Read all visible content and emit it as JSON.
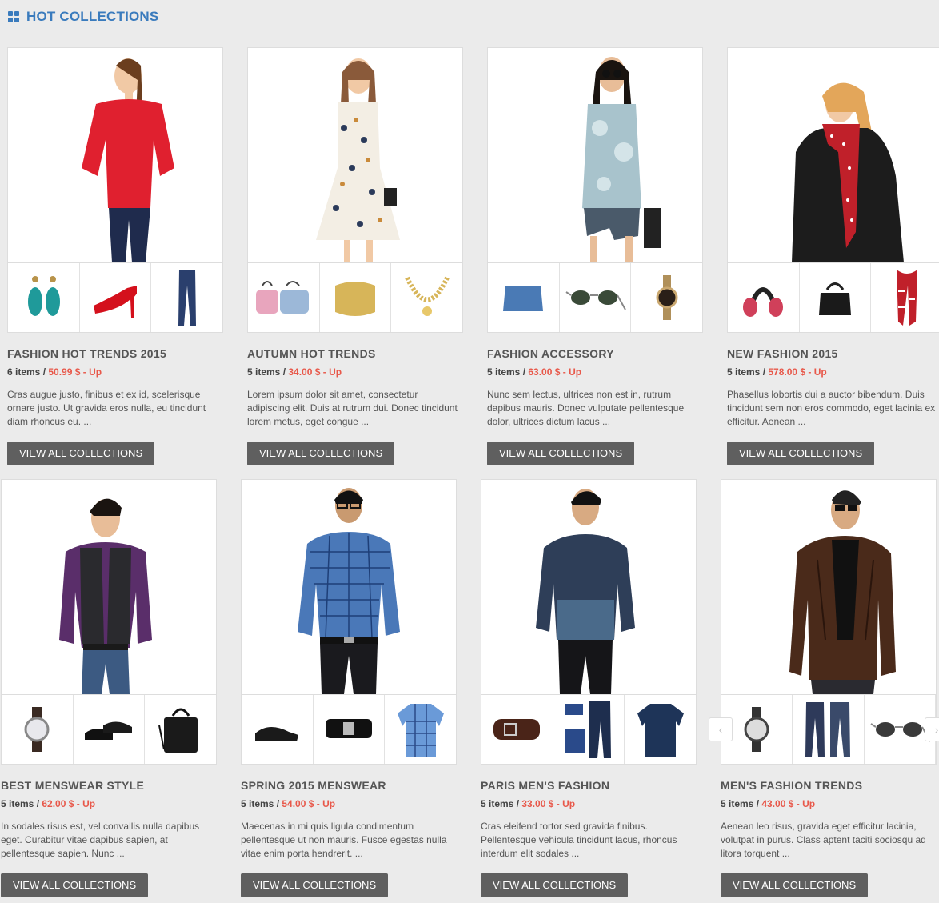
{
  "section": {
    "title": "HOT COLLECTIONS",
    "icon": "grid-icon"
  },
  "collections": [
    {
      "title": "FASHION HOT TRENDS 2015",
      "count": "6 items",
      "sep": " / ",
      "price": "50.99 $ - Up",
      "desc": "Cras augue justo, finibus et ex id, scelerisque ornare justo. Ut gravida eros nulla, eu tincidunt diam rhoncus eu. ...",
      "button": "VIEW ALL COLLECTIONS",
      "model": "woman in red blouse and jeans",
      "thumbs": [
        "turquoise earrings",
        "red high heel",
        "blue jeans"
      ]
    },
    {
      "title": "AUTUMN HOT TRENDS",
      "count": "5 items",
      "sep": " / ",
      "price": "34.00 $ - Up",
      "desc": "Lorem ipsum dolor sit amet, consectetur adipiscing elit. Duis at rutrum dui. Donec tincidunt lorem metus, eget congue ...",
      "button": "VIEW ALL COLLECTIONS",
      "model": "woman in floral dress",
      "thumbs": [
        "handbags",
        "gold cuff bracelet",
        "gold necklace"
      ]
    },
    {
      "title": "FASHION ACCESSORY",
      "count": "5 items",
      "sep": " / ",
      "price": "63.00 $ - Up",
      "desc": "Nunc sem lectus, ultrices non est in, rutrum dapibus mauris. Donec vulputate pellentesque dolor, ultrices dictum lacus ...",
      "button": "VIEW ALL COLLECTIONS",
      "model": "woman in tie-dye top and denim shorts",
      "thumbs": [
        "denim skirt",
        "aviator sunglasses",
        "wrist watch"
      ]
    },
    {
      "title": "NEW FASHION 2015",
      "count": "5 items",
      "sep": " / ",
      "price": "578.00 $ - Up",
      "desc": "Phasellus lobortis dui a auctor bibendum. Duis tincidunt sem non eros commodo, eget lacinia ex efficitur. Aenean ...",
      "button": "VIEW ALL COLLECTIONS",
      "model": "woman in black coat and red scarf",
      "thumbs": [
        "earmuffs",
        "black handbag",
        "knit scarf"
      ]
    },
    {
      "title": "BEST MENSWEAR STYLE",
      "count": "5 items",
      "sep": " / ",
      "price": "62.00 $ - Up",
      "desc": "In sodales risus est, vel convallis nulla dapibus eget. Curabitur vitae dapibus sapien, at pellentesque sapien. Nunc ...",
      "button": "VIEW ALL COLLECTIONS",
      "model": "man in black vest",
      "thumbs": [
        "wrist watch",
        "dress shoes",
        "leather bag"
      ]
    },
    {
      "title": "SPRING 2015 MENSWEAR",
      "count": "5 items",
      "sep": " / ",
      "price": "54.00 $ - Up",
      "desc": "Maecenas in mi quis ligula condimentum pellentesque ut non mauris. Fusce egestas nulla vitae enim porta hendrerit. ...",
      "button": "VIEW ALL COLLECTIONS",
      "model": "man in blue plaid shirt",
      "thumbs": [
        "black shoe",
        "black belt",
        "plaid shirt"
      ]
    },
    {
      "title": "PARIS MEN'S FASHION",
      "count": "5 items",
      "sep": " / ",
      "price": "33.00 $ - Up",
      "desc": "Cras eleifend tortor sed gravida finibus. Pellentesque vehicula tincidunt lacus, rhoncus interdum elit sodales ...",
      "button": "VIEW ALL COLLECTIONS",
      "model": "man in denim shirt",
      "thumbs": [
        "brown belt",
        "jeans set",
        "denim shirt"
      ]
    },
    {
      "title": "MEN'S FASHION TRENDS",
      "count": "5 items",
      "sep": " / ",
      "price": "43.00 $ - Up",
      "desc": "Aenean leo risus, gravida eget efficitur lacinia, volutpat in purus. Class aptent taciti sociosqu ad litora torquent ...",
      "button": "VIEW ALL COLLECTIONS",
      "model": "man in brown leather jacket",
      "thumbs": [
        "wrist watch",
        "jeans",
        "aviator sunglasses"
      ]
    }
  ],
  "carousel": {
    "prev_icon": "chevron-left-icon",
    "next_icon": "chevron-right-icon",
    "prev_glyph": "‹",
    "next_glyph": "›"
  },
  "colors": {
    "accent": "#3a7bbd",
    "price": "#e8584a",
    "button_bg": "#5f5f5f",
    "page_bg": "#ebebeb"
  }
}
